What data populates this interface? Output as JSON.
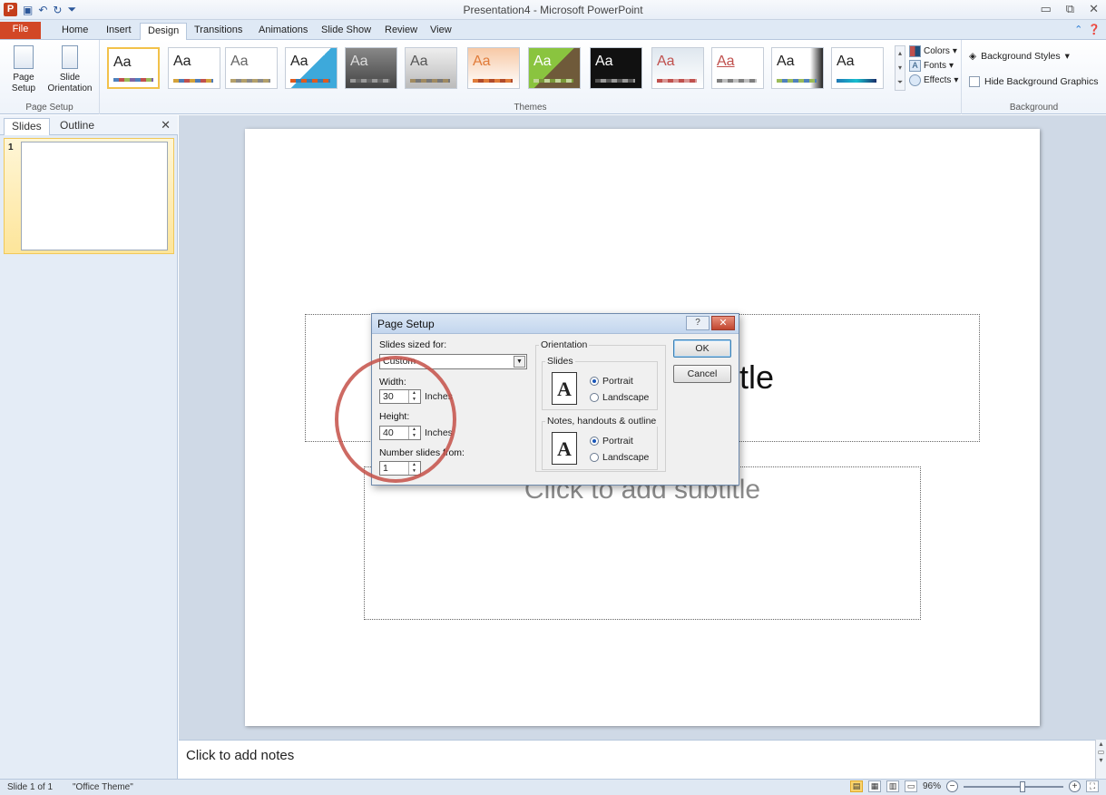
{
  "window": {
    "title": "Presentation4 - Microsoft PowerPoint",
    "app_icon": "P"
  },
  "tabs": [
    "File",
    "Home",
    "Insert",
    "Design",
    "Transitions",
    "Animations",
    "Slide Show",
    "Review",
    "View"
  ],
  "ribbon": {
    "page_setup": {
      "page_setup_label": "Page Setup",
      "slide_orientation_label": "Slide Orientation",
      "group_label": "Page Setup"
    },
    "themes": {
      "group_label": "Themes",
      "tile_text": "Aa",
      "colors": "Colors",
      "fonts": "Fonts",
      "effects": "Effects"
    },
    "background": {
      "group_label": "Background",
      "background_styles": "Background Styles",
      "hide_background_graphics": "Hide Background Graphics"
    }
  },
  "slides_pane": {
    "tab_slides": "Slides",
    "tab_outline": "Outline",
    "slide_number": "1"
  },
  "slide": {
    "title_visible_text": "itle",
    "subtitle_placeholder": "Click to add subtitle"
  },
  "notes": {
    "placeholder": "Click to add notes"
  },
  "statusbar": {
    "slide_count": "Slide 1 of 1",
    "theme": "\"Office Theme\"",
    "zoom": "96%"
  },
  "dialog": {
    "title": "Page Setup",
    "help_btn": "?",
    "slides_sized_for_label": "Slides sized for:",
    "slides_sized_for_value": "Custom",
    "width_label": "Width:",
    "width_value": "30",
    "height_label": "Height:",
    "height_value": "40",
    "unit": "Inches",
    "number_slides_from_label": "Number slides from:",
    "number_slides_from_value": "1",
    "orientation_label": "Orientation",
    "slides_label": "Slides",
    "notes_label": "Notes, handouts & outline",
    "portrait": "Portrait",
    "landscape": "Landscape",
    "ok": "OK",
    "cancel": "Cancel",
    "doc_icon_letter": "A"
  },
  "colors": {
    "accent": "#d24726",
    "highlight_ring": "#c45048",
    "selected_theme_border": "#f2c14a"
  }
}
